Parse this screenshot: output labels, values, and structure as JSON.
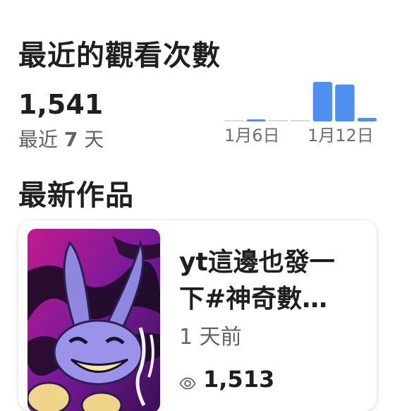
{
  "recent_views": {
    "title": "最近的觀看次數",
    "count": "1,541",
    "period_prefix": "最近",
    "period_number": "7",
    "period_suffix": "天"
  },
  "chart_data": {
    "type": "bar",
    "categories": [
      "1月6日",
      "",
      "",
      "",
      "",
      "",
      "1月12日"
    ],
    "tick_labels": [
      "1月6日",
      "1月12日"
    ],
    "values": [
      0,
      2,
      0,
      0,
      760,
      710,
      69
    ],
    "color": "#4f8ff0",
    "baseline_color": "#d7d9dc"
  },
  "latest": {
    "title": "最新作品",
    "video": {
      "title_line1": "yt這邊也發一",
      "title_line2": "下#神奇數…",
      "age": "1 天前",
      "views": "1,513",
      "views_icon": "eye-icon"
    }
  },
  "colors": {
    "accent": "#4f8ff0",
    "text": "#1f1f1f",
    "secondary": "#5f6368"
  }
}
